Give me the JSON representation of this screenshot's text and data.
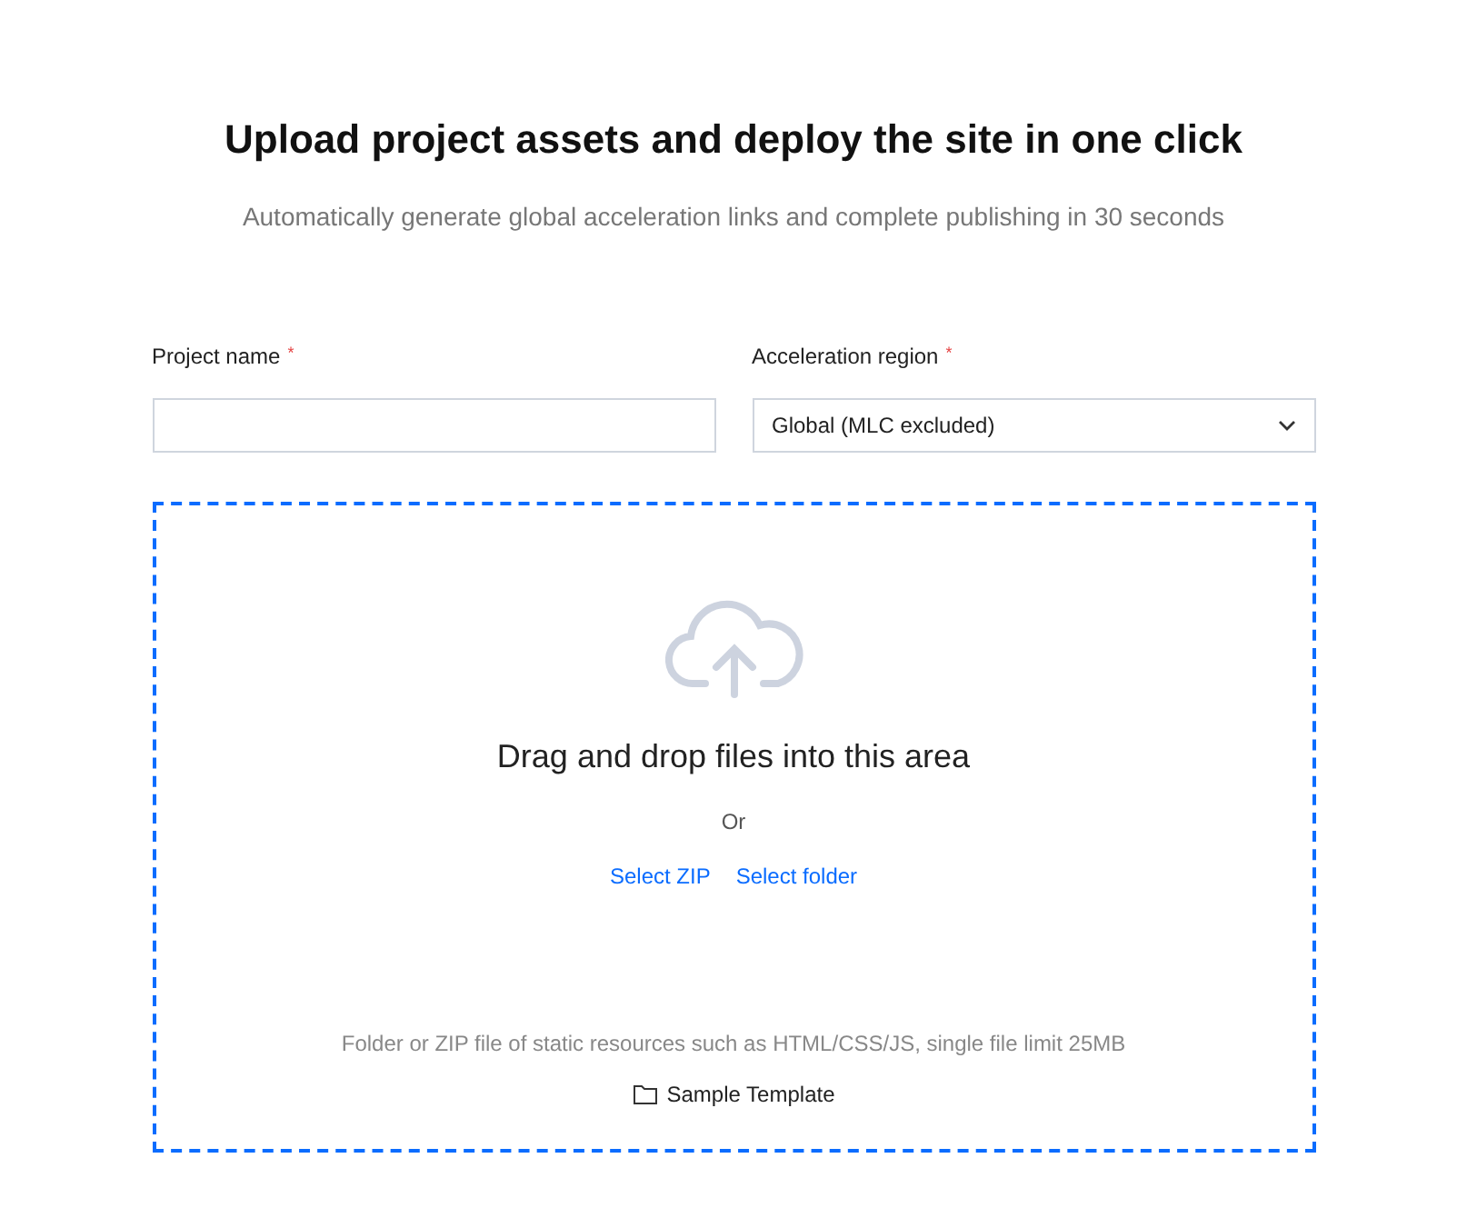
{
  "title": "Upload project assets and deploy the site in one click",
  "subtitle": "Automatically generate global acceleration links and complete publishing in 30 seconds",
  "fields": [
    {
      "kind": "input",
      "label": "Project name",
      "required_mark": "*"
    },
    {
      "kind": "select",
      "label": "Acceleration region",
      "required_mark": "*",
      "value": "Global (MLC excluded)"
    }
  ],
  "dropzone": {
    "heading": "Drag and drop files into this area",
    "or": "Or",
    "links": [
      "Select ZIP",
      "Select folder"
    ],
    "hint": "Folder or ZIP file of static resources such as HTML/CSS/JS, single file limit 25MB",
    "template_link": "Sample Template"
  }
}
